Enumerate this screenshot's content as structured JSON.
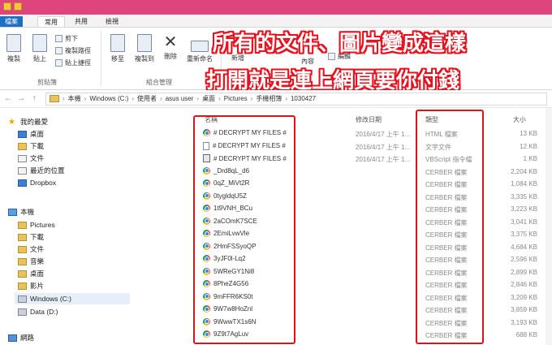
{
  "ribbon_tabs": {
    "file": "檔案",
    "home": "常用",
    "share": "共用",
    "view": "檢視"
  },
  "ribbon": {
    "copy": "複製",
    "paste": "貼上",
    "cut": "剪下",
    "copy_path": "複製路徑",
    "paste_shortcut": "貼上捷徑",
    "move_to": "移至",
    "copy_to": "複製到",
    "delete": "刪除",
    "rename": "重新命名",
    "new": "新增",
    "properties": "內容",
    "edit": "編輯",
    "clipboard_group": "剪貼簿",
    "organize_group": "組合管理"
  },
  "overlay": {
    "line1": "所有的文件、圖片變成這樣",
    "line2": "打開就是連上網頁要你付錢"
  },
  "address": {
    "crumbs": [
      "本機",
      "Windows (C:)",
      "使用者",
      "asus user",
      "桌面",
      "Pictures",
      "手機相簿",
      "1030427"
    ]
  },
  "columns": {
    "name": "名稱",
    "date": "修改日期",
    "type": "類型",
    "size": "大小"
  },
  "nav": {
    "favorites": "我的最愛",
    "desktop": "桌面",
    "downloads": "下載",
    "documents": "文件",
    "recent": "最近的位置",
    "dropbox": "Dropbox",
    "this_pc": "本機",
    "pictures": "Pictures",
    "pc_downloads": "下載",
    "pc_documents": "文件",
    "music": "音樂",
    "pc_desktop": "桌面",
    "videos": "影片",
    "windows_c": "Windows (C:)",
    "data_d": "Data (D:)",
    "network": "網路"
  },
  "files": [
    {
      "name": "# DECRYPT MY FILES #",
      "date": "2016/4/17 上午 1...",
      "type": "HTML 檔案",
      "size": "13 KB",
      "icon": "chrome-icon"
    },
    {
      "name": "# DECRYPT MY FILES #",
      "date": "2016/4/17 上午 1...",
      "type": "文字文件",
      "size": "12 KB",
      "icon": "text-file-icon"
    },
    {
      "name": "# DECRYPT MY FILES #",
      "date": "2016/4/17 上午 1...",
      "type": "VBScript 指令檔",
      "size": "1 KB",
      "icon": "vbscript-icon"
    },
    {
      "name": "_Drd8qL_d6",
      "date": "",
      "type": "CERBER 檔案",
      "size": "2,204 KB",
      "icon": "chrome-icon"
    },
    {
      "name": "0qZ_MiVt2R",
      "date": "",
      "type": "CERBER 檔案",
      "size": "1,084 KB",
      "icon": "chrome-icon"
    },
    {
      "name": "0tygldqU5Z",
      "date": "",
      "type": "CERBER 檔案",
      "size": "3,335 KB",
      "icon": "chrome-icon"
    },
    {
      "name": "1t9VNH_BCu",
      "date": "",
      "type": "CERBER 檔案",
      "size": "3,223 KB",
      "icon": "chrome-icon"
    },
    {
      "name": "2aCOmK7SCE",
      "date": "",
      "type": "CERBER 檔案",
      "size": "3,041 KB",
      "icon": "chrome-icon"
    },
    {
      "name": "2EmiLvwVle",
      "date": "",
      "type": "CERBER 檔案",
      "size": "3,375 KB",
      "icon": "chrome-icon"
    },
    {
      "name": "2HmFSSyoQP",
      "date": "",
      "type": "CERBER 檔案",
      "size": "4,684 KB",
      "icon": "chrome-icon"
    },
    {
      "name": "3yJF0l-Lq2",
      "date": "",
      "type": "CERBER 檔案",
      "size": "2,596 KB",
      "icon": "chrome-icon"
    },
    {
      "name": "5WReGY1Ni8",
      "date": "",
      "type": "CERBER 檔案",
      "size": "2,899 KB",
      "icon": "chrome-icon"
    },
    {
      "name": "8PheZ4G56",
      "date": "",
      "type": "CERBER 檔案",
      "size": "2,846 KB",
      "icon": "chrome-icon"
    },
    {
      "name": "9mFFR6KS0t",
      "date": "",
      "type": "CERBER 檔案",
      "size": "3,209 KB",
      "icon": "chrome-icon"
    },
    {
      "name": "9W7w8HoZnl",
      "date": "",
      "type": "CERBER 檔案",
      "size": "3,859 KB",
      "icon": "chrome-icon"
    },
    {
      "name": "9WwwTX1s6N",
      "date": "",
      "type": "CERBER 檔案",
      "size": "3,193 KB",
      "icon": "chrome-icon"
    },
    {
      "name": "9Z9t7AgLuv",
      "date": "",
      "type": "CERBER 檔案",
      "size": "688 KB",
      "icon": "chrome-icon"
    }
  ],
  "colors": {
    "title_bar": "#e0447c",
    "file_tab": "#1e6fc3",
    "highlight": "#d9141b",
    "overlay_stroke": "#e8101c"
  }
}
